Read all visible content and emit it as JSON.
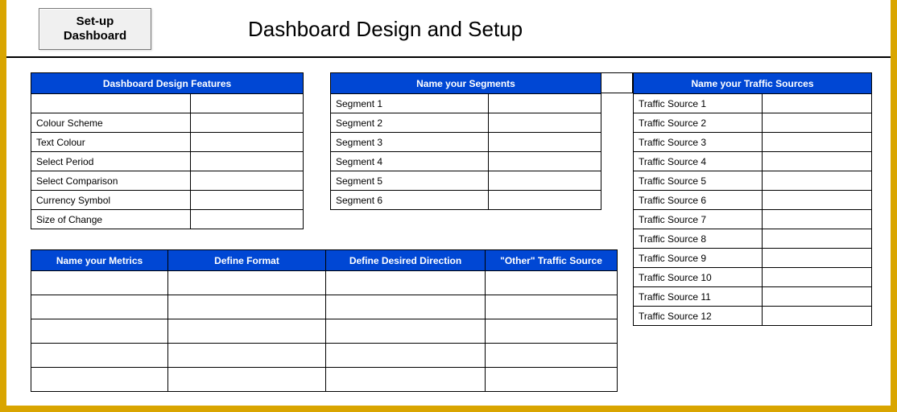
{
  "header": {
    "button_line1": "Set-up",
    "button_line2": "Dashboard",
    "title": "Dashboard Design and Setup"
  },
  "features": {
    "header": "Dashboard Design Features",
    "rows": [
      {
        "label": "",
        "value": ""
      },
      {
        "label": "Colour Scheme",
        "value": ""
      },
      {
        "label": "Text Colour",
        "value": ""
      },
      {
        "label": "Select Period",
        "value": ""
      },
      {
        "label": "Select Comparison",
        "value": ""
      },
      {
        "label": "Currency Symbol",
        "value": ""
      },
      {
        "label": "Size of Change",
        "value": ""
      }
    ]
  },
  "segments": {
    "header": "Name your Segments",
    "rows": [
      {
        "label": "Segment 1",
        "value": ""
      },
      {
        "label": "Segment 2",
        "value": ""
      },
      {
        "label": "Segment 3",
        "value": ""
      },
      {
        "label": "Segment 4",
        "value": ""
      },
      {
        "label": "Segment 5",
        "value": ""
      },
      {
        "label": "Segment 6",
        "value": ""
      }
    ]
  },
  "traffic": {
    "header": "Name your Traffic Sources",
    "rows": [
      {
        "label": "Traffic Source 1",
        "value": ""
      },
      {
        "label": "Traffic Source 2",
        "value": ""
      },
      {
        "label": "Traffic Source 3",
        "value": ""
      },
      {
        "label": "Traffic Source 4",
        "value": ""
      },
      {
        "label": "Traffic Source 5",
        "value": ""
      },
      {
        "label": "Traffic Source 6",
        "value": ""
      },
      {
        "label": "Traffic Source 7",
        "value": ""
      },
      {
        "label": "Traffic Source 8",
        "value": ""
      },
      {
        "label": "Traffic Source 9",
        "value": ""
      },
      {
        "label": "Traffic Source 10",
        "value": ""
      },
      {
        "label": "Traffic Source 11",
        "value": ""
      },
      {
        "label": "Traffic Source 12",
        "value": ""
      }
    ]
  },
  "metrics": {
    "headers": {
      "c1": "Name your Metrics",
      "c2": "Define Format",
      "c3": "Define Desired Direction",
      "c4": "\"Other\" Traffic Source"
    },
    "row_count": 5
  }
}
